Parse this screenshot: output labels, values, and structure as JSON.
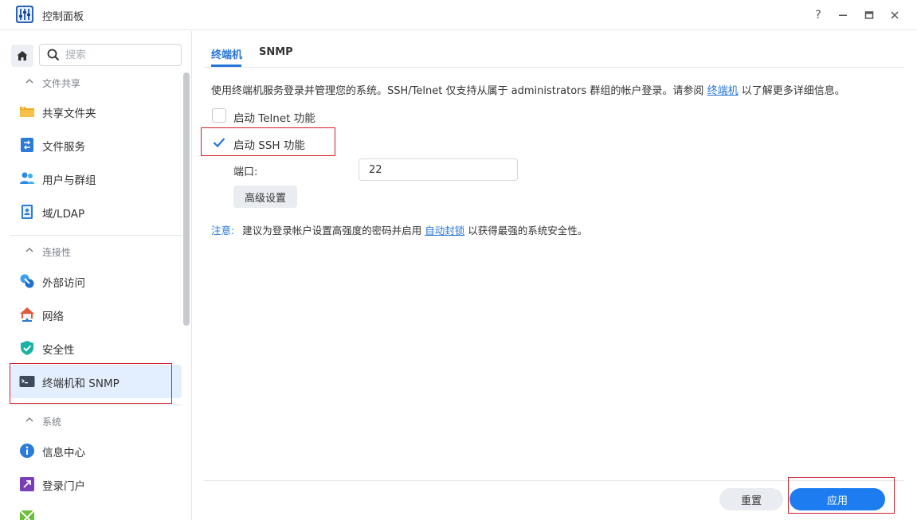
{
  "window": {
    "title": "控制面板",
    "help_label": "?",
    "minimize_label": "▬",
    "maximize_label": "▭",
    "close_label": "✕"
  },
  "sidebar": {
    "search_placeholder": "搜索",
    "groups": [
      {
        "label": "文件共享",
        "items": [
          {
            "label": "共享文件夹",
            "icon": "folder-icon"
          },
          {
            "label": "文件服务",
            "icon": "file-service-icon"
          },
          {
            "label": "用户与群组",
            "icon": "users-icon"
          },
          {
            "label": "域/LDAP",
            "icon": "ldap-icon"
          }
        ]
      },
      {
        "label": "连接性",
        "items": [
          {
            "label": "外部访问",
            "icon": "external-access-icon"
          },
          {
            "label": "网络",
            "icon": "network-house-icon"
          },
          {
            "label": "安全性",
            "icon": "shield-icon"
          },
          {
            "label": "终端机和 SNMP",
            "icon": "terminal-icon",
            "active": true
          }
        ]
      },
      {
        "label": "系统",
        "items": [
          {
            "label": "信息中心",
            "icon": "info-icon"
          },
          {
            "label": "登录门户",
            "icon": "login-portal-icon"
          }
        ]
      }
    ]
  },
  "main": {
    "tabs": [
      {
        "label": "终端机",
        "active": true
      },
      {
        "label": "SNMP",
        "active": false
      }
    ],
    "description": {
      "before": "使用终端机服务登录并管理您的系统。SSH/Telnet 仅支持从属于 administrators 群组的帐户登录。请参阅 ",
      "link": "终端机",
      "after": " 以了解更多详细信息。"
    },
    "telnet": {
      "label": "启动 Telnet 功能",
      "checked": false
    },
    "ssh": {
      "label": "启动 SSH 功能",
      "checked": true
    },
    "port": {
      "label": "端口:",
      "value": "22"
    },
    "advanced_label": "高级设置",
    "note": {
      "label": "注意:",
      "before": "建议为登录帐户设置高强度的密码并启用 ",
      "link": "自动封锁",
      "after": " 以获得最强的系统安全性。"
    }
  },
  "footer": {
    "reset_label": "重置",
    "apply_label": "应用"
  },
  "colors": {
    "accent": "#2575d8",
    "apply": "#1d7df0",
    "highlight": "#d0202a"
  }
}
